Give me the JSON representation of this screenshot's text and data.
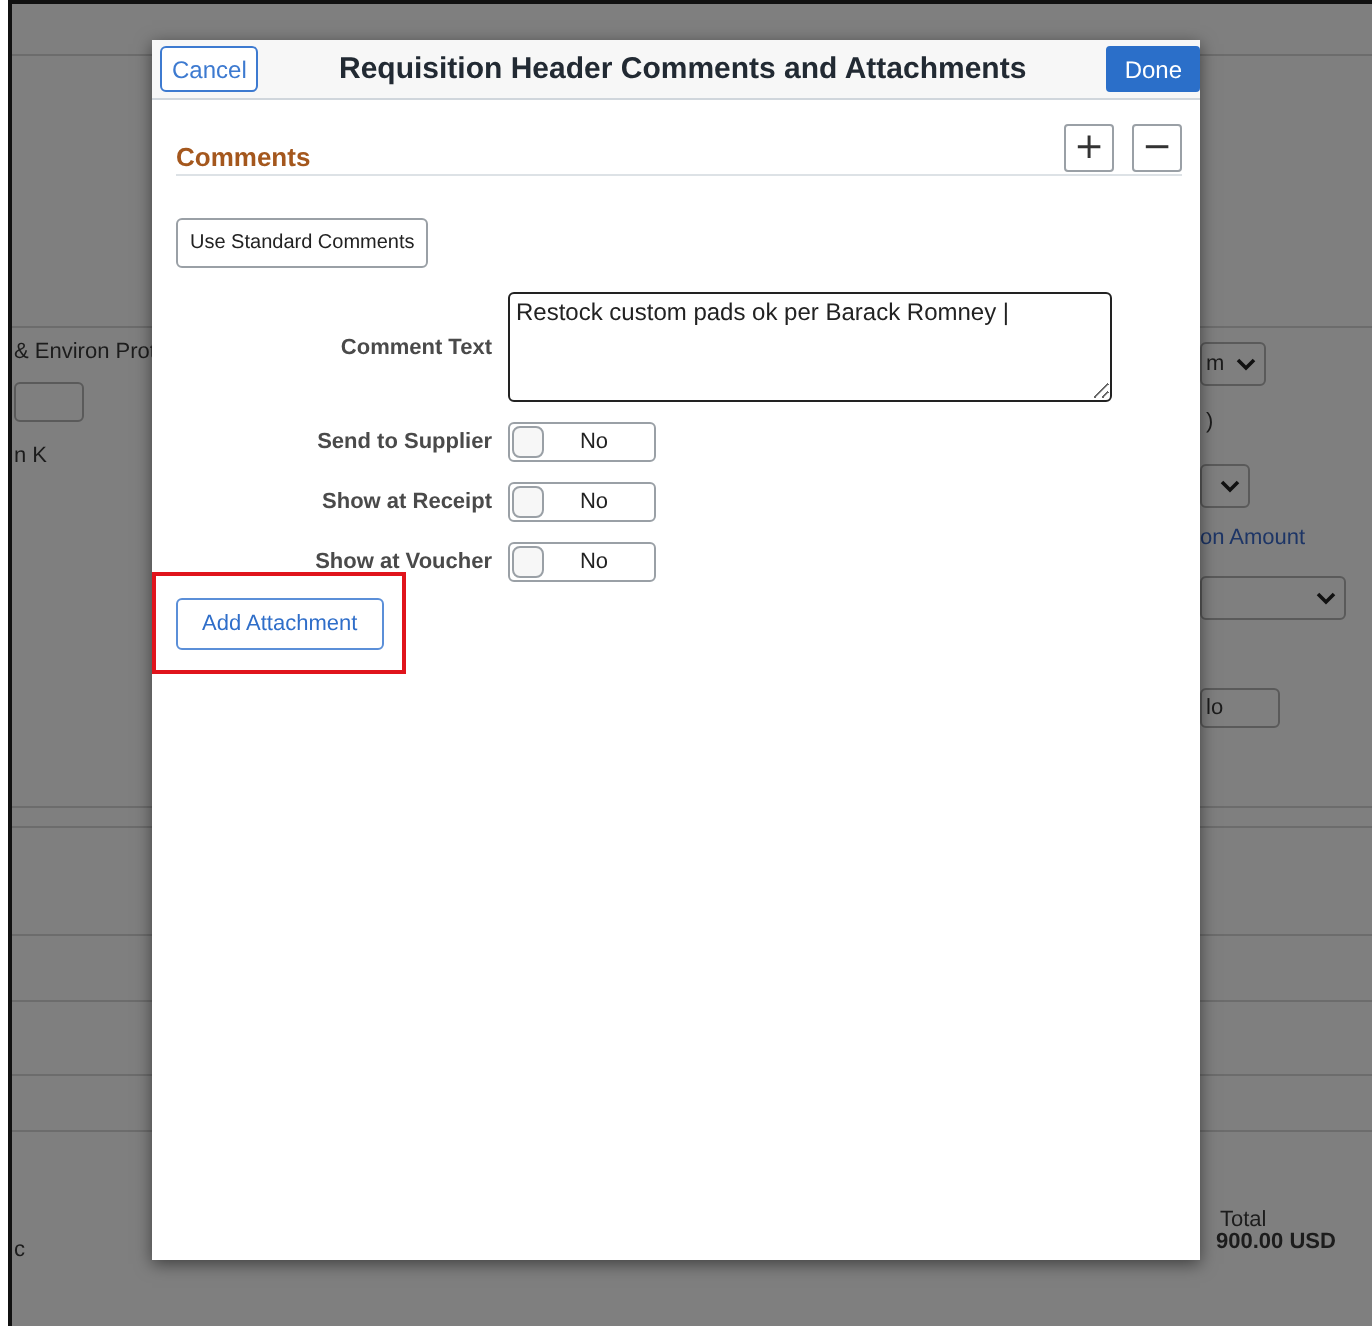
{
  "background": {
    "texts": [
      {
        "kind": "label",
        "text": "& Environ Prot"
      },
      {
        "kind": "input"
      },
      {
        "kind": "label",
        "text": "n K"
      },
      {
        "kind": "select",
        "text": "m"
      },
      {
        "kind": "label",
        "text": ")"
      },
      {
        "kind": "select"
      },
      {
        "kind": "link",
        "text": "on Amount"
      },
      {
        "kind": "select"
      },
      {
        "kind": "input",
        "text": "lo"
      },
      {
        "kind": "label",
        "text": "Total"
      },
      {
        "kind": "total",
        "text": "900.00 USD"
      },
      {
        "kind": "label",
        "text": "c"
      }
    ]
  },
  "dialog": {
    "title": "Requisition Header Comments and Attachments",
    "cancel": "Cancel",
    "done": "Done",
    "section": "Comments",
    "add": "+",
    "remove": "−",
    "standard_button": "Use Standard Comments",
    "comment_label": "Comment Text",
    "comment_value": "Restock custom pads ok per Barack Romney |",
    "toggles": [
      {
        "label": "Send to Supplier",
        "on": false,
        "text": "No"
      },
      {
        "label": "Show at Receipt",
        "on": false,
        "text": "No"
      },
      {
        "label": "Show at Voucher",
        "on": false,
        "text": "No"
      }
    ],
    "attachment_button": "Add Attachment",
    "highlighted": true
  }
}
